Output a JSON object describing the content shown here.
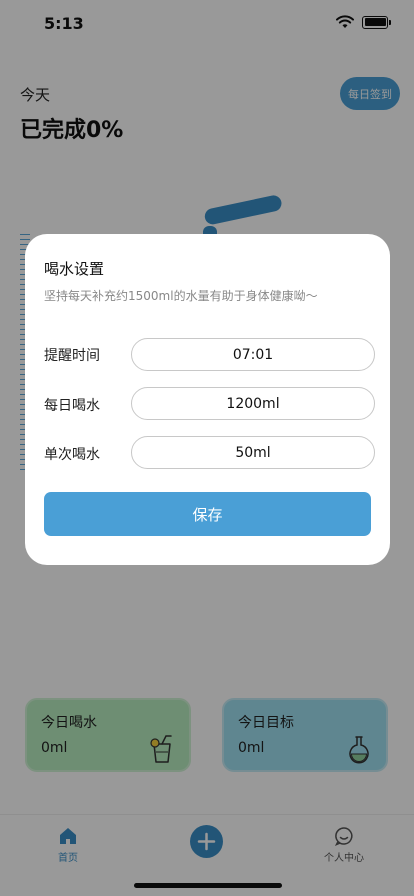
{
  "status_bar": {
    "time": "5:13"
  },
  "header": {
    "today": "今天",
    "completed": "已完成0%",
    "checkin_button": "每日签到"
  },
  "cards": {
    "water": {
      "title": "今日喝水",
      "value": "0ml"
    },
    "goal": {
      "title": "今日目标",
      "value": "0ml"
    }
  },
  "tabbar": {
    "home": "首页",
    "profile": "个人中心"
  },
  "modal": {
    "title": "喝水设置",
    "description": "坚持每天补充约1500ml的水量有助于身体健康呦～",
    "rows": [
      {
        "label": "提醒时间",
        "value": "07:01"
      },
      {
        "label": "每日喝水",
        "value": "1200ml"
      },
      {
        "label": "单次喝水",
        "value": "50ml"
      }
    ],
    "save_button": "保存"
  },
  "colors": {
    "accent": "#4a9fd6",
    "water_card": "#b7edc0",
    "goal_card": "#9ee0f0"
  }
}
